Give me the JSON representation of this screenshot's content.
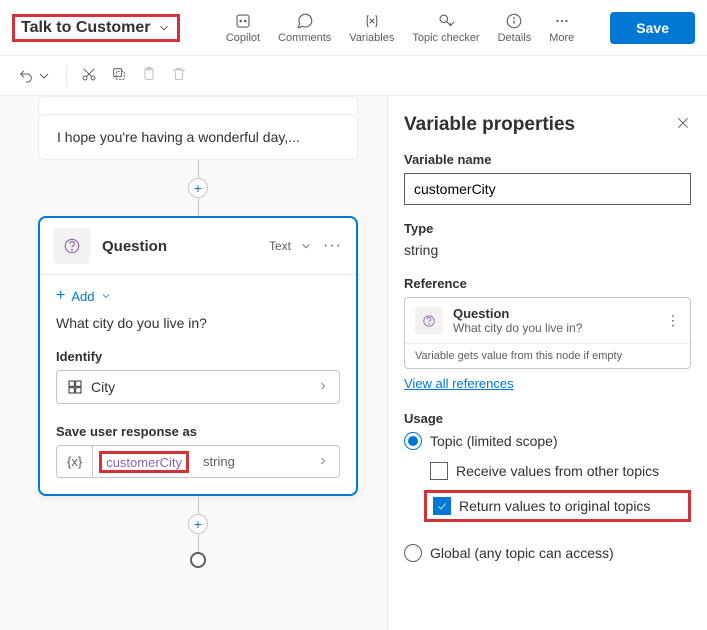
{
  "header": {
    "topic_title": "Talk to Customer",
    "actions": {
      "copilot": "Copilot",
      "comments": "Comments",
      "variables": "Variables",
      "topic_checker": "Topic checker",
      "details": "Details",
      "more": "More"
    },
    "save_label": "Save"
  },
  "canvas": {
    "message_text": "I hope you're having a wonderful day,...",
    "question": {
      "title": "Question",
      "output_type": "Text",
      "add_label": "Add",
      "prompt": "What city do you live in?",
      "identify_label": "Identify",
      "identify_value": "City",
      "save_label": "Save user response as",
      "var_name": "customerCity",
      "var_type": "string"
    }
  },
  "panel": {
    "title": "Variable properties",
    "name_label": "Variable name",
    "name_value": "customerCity",
    "type_label": "Type",
    "type_value": "string",
    "reference_label": "Reference",
    "reference_title": "Question",
    "reference_subtitle": "What city do you live in?",
    "reference_note": "Variable gets value from this node if empty",
    "view_all": "View all references",
    "usage_label": "Usage",
    "scope_topic": "Topic (limited scope)",
    "receive_values": "Receive values from other topics",
    "return_values": "Return values to original topics",
    "scope_global": "Global (any topic can access)"
  }
}
